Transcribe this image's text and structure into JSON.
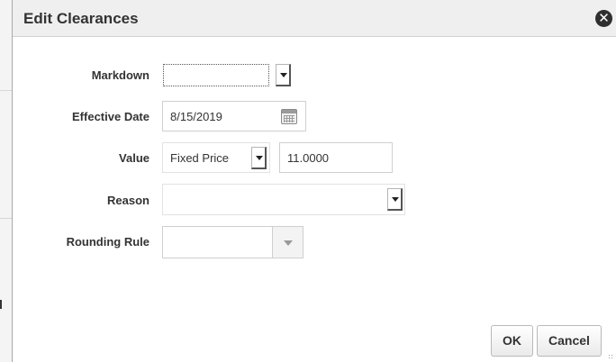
{
  "dialog": {
    "title": "Edit Clearances",
    "close_icon": "close-icon"
  },
  "form": {
    "markdown": {
      "label": "Markdown",
      "value": ""
    },
    "effective_date": {
      "label": "Effective Date",
      "value": "8/15/2019",
      "icon": "calendar-icon"
    },
    "value": {
      "label": "Value",
      "type_value": "Fixed Price",
      "amount": "11.0000"
    },
    "reason": {
      "label": "Reason",
      "value": ""
    },
    "rounding_rule": {
      "label": "Rounding Rule",
      "value": ""
    }
  },
  "buttons": {
    "ok": "OK",
    "cancel": "Cancel"
  }
}
